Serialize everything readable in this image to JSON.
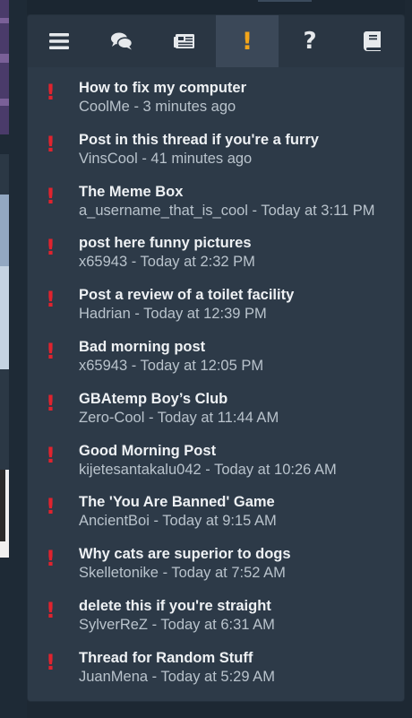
{
  "tabs": [
    {
      "icon": "menu-icon",
      "active": false
    },
    {
      "icon": "conversations-icon",
      "active": false
    },
    {
      "icon": "news-icon",
      "active": false
    },
    {
      "icon": "alerts-icon",
      "label": "!",
      "active": true
    },
    {
      "icon": "help-icon",
      "label": "?",
      "active": false
    },
    {
      "icon": "book-icon",
      "active": false
    }
  ],
  "colors": {
    "alert_mark": "#e0232e",
    "active_tab_icon": "#f2a51a",
    "panel_bg": "#2d3a48"
  },
  "threads": [
    {
      "title": "How to fix my computer",
      "author": "CoolMe",
      "time": "3 minutes ago"
    },
    {
      "title": "Post in this thread if you're a furry",
      "author": "VinsCool",
      "time": "41 minutes ago"
    },
    {
      "title": "The Meme Box",
      "author": "a_username_that_is_cool",
      "time": "Today at 3:11 PM"
    },
    {
      "title": "post here funny pictures",
      "author": "x65943",
      "time": "Today at 2:32 PM"
    },
    {
      "title": "Post a review of a toilet facility",
      "author": "Hadrian",
      "time": "Today at 12:39 PM"
    },
    {
      "title": "Bad morning post",
      "author": "x65943",
      "time": "Today at 12:05 PM"
    },
    {
      "title": "GBAtemp Boy’s Club",
      "author": "Zero-Cool",
      "time": "Today at 11:44 AM"
    },
    {
      "title": "Good Morning Post",
      "author": "kijetesantakalu042",
      "time": "Today at 10:26 AM"
    },
    {
      "title": "The 'You Are Banned' Game",
      "author": "AncientBoi",
      "time": "Today at 9:15 AM"
    },
    {
      "title": "Why cats are superior to dogs",
      "author": "Skelletonike",
      "time": "Today at 7:52 AM"
    },
    {
      "title": "delete this if you're straight",
      "author": "SylverReZ",
      "time": "Today at 6:31 AM"
    },
    {
      "title": "Thread for Random Stuff",
      "author": "JuanMena",
      "time": "Today at 5:29 AM"
    }
  ]
}
